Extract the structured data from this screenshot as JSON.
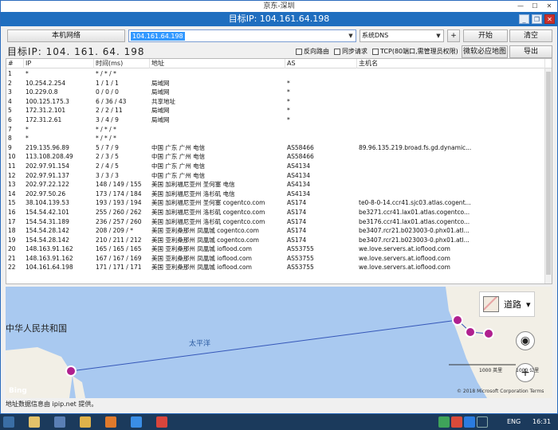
{
  "window": {
    "outer_title": "京东-深圳",
    "title": "目标IP: 104.161.64.198"
  },
  "toolbar": {
    "local_network_label": "本机网络",
    "ip_value": "104.161.64.198",
    "dns_value": "系统DNS",
    "plus_label": "+",
    "start_label": "开始",
    "clear_label": "清空"
  },
  "target": {
    "label": "目标IP:  104. 161. 64. 198"
  },
  "options": {
    "reverse_route": "反向路由",
    "sync_request": "同步请求",
    "tcp_mode": "TCP(80端口,需管理员权限)",
    "map_toggle": "微软必应地图",
    "export": "导出"
  },
  "table": {
    "columns": [
      "#",
      "IP",
      "时间(ms)",
      "地址",
      "AS",
      "主机名"
    ],
    "rows": [
      [
        "1",
        "*",
        "* / * / *",
        "",
        "",
        ""
      ],
      [
        "2",
        "10.254.2.254",
        "1 / 1 / 1",
        "局域网",
        "*",
        ""
      ],
      [
        "3",
        "10.229.0.8",
        "0 / 0 / 0",
        "局域网",
        "*",
        ""
      ],
      [
        "4",
        "100.125.175.3",
        "6 / 36 / 43",
        "共享地址",
        "*",
        ""
      ],
      [
        "5",
        "172.31.2.101",
        "2 / 2 / 11",
        "局域网",
        "*",
        ""
      ],
      [
        "6",
        "172.31.2.61",
        "3 / 4 / 9",
        "局域网",
        "*",
        ""
      ],
      [
        "7",
        "*",
        "* / * / *",
        "",
        "",
        ""
      ],
      [
        "8",
        "*",
        "* / * / *",
        "",
        "",
        ""
      ],
      [
        "9",
        "219.135.96.89",
        "5 / 7 / 9",
        "中国 广东 广州 电信",
        "AS58466",
        "89.96.135.219.broad.fs.gd.dynamic..."
      ],
      [
        "10",
        "113.108.208.49",
        "2 / 3 / 5",
        "中国 广东 广州 电信",
        "AS58466",
        ""
      ],
      [
        "11",
        "202.97.91.154",
        "2 / 4 / 5",
        "中国 广东 广州 电信",
        "AS4134",
        ""
      ],
      [
        "12",
        "202.97.91.137",
        "3 / 3 / 3",
        "中国 广东 广州 电信",
        "AS4134",
        ""
      ],
      [
        "13",
        "202.97.22.122",
        "148 / 149 / 155",
        "美国 加利福尼亚州 圣何塞 电信",
        "AS4134",
        ""
      ],
      [
        "14",
        "202.97.50.26",
        "173 / 174 / 184",
        "美国 加利福尼亚州 洛杉矶 电信",
        "AS4134",
        ""
      ],
      [
        "15",
        "38.104.139.53",
        "193 / 193 / 194",
        "美国 加利福尼亚州 圣何塞 cogentco.com",
        "AS174",
        "te0-8-0-14.ccr41.sjc03.atlas.cogent..."
      ],
      [
        "16",
        "154.54.42.101",
        "255 / 260 / 262",
        "美国 加利福尼亚州 洛杉矶 cogentco.com",
        "AS174",
        "be3271.ccr41.lax01.atlas.cogentco..."
      ],
      [
        "17",
        "154.54.31.189",
        "236 / 257 / 260",
        "美国 加利福尼亚州 洛杉矶 cogentco.com",
        "AS174",
        "be3176.ccr41.lax01.atlas.cogentco..."
      ],
      [
        "18",
        "154.54.28.142",
        "208 / 209 / *",
        "美国 亚利桑那州 凤凰城 cogentco.com",
        "AS174",
        "be3407.rcr21.b023003-0.phx01.atl..."
      ],
      [
        "19",
        "154.54.28.142",
        "210 / 211 / 212",
        "美国 亚利桑那州 凤凰城 cogentco.com",
        "AS174",
        "be3407.rcr21.b023003-0.phx01.atl..."
      ],
      [
        "20",
        "148.163.91.162",
        "165 / 165 / 165",
        "美国 亚利桑那州 凤凰城 ioflood.com",
        "AS53755",
        "we.love.servers.at.ioflood.com"
      ],
      [
        "21",
        "148.163.91.162",
        "167 / 167 / 169",
        "美国 亚利桑那州 凤凰城 ioflood.com",
        "AS53755",
        "we.love.servers.at.ioflood.com"
      ],
      [
        "22",
        "104.161.64.198",
        "171 / 171 / 171",
        "美国 亚利桑那州 凤凰城 ioflood.com",
        "AS53755",
        "we.love.servers.at.ioflood.com"
      ]
    ]
  },
  "map": {
    "china_label": "中华人民共和国",
    "ocean_label": "太平洋",
    "map_type": "道路",
    "bing": "Bing",
    "scale_km": "1000 英里",
    "scale_km2": "1000 公里",
    "copyright": "© 2018 Microsoft Corporation  Terms"
  },
  "status": {
    "text": "地址数据信息由 ipip.net 提供。"
  },
  "taskbar": {
    "lang": "ENG",
    "time": "16:31"
  },
  "colors": {
    "title_bar": "#1f6ebf",
    "route_marker": "#b0208f",
    "map_water": "#a9c9f0"
  }
}
